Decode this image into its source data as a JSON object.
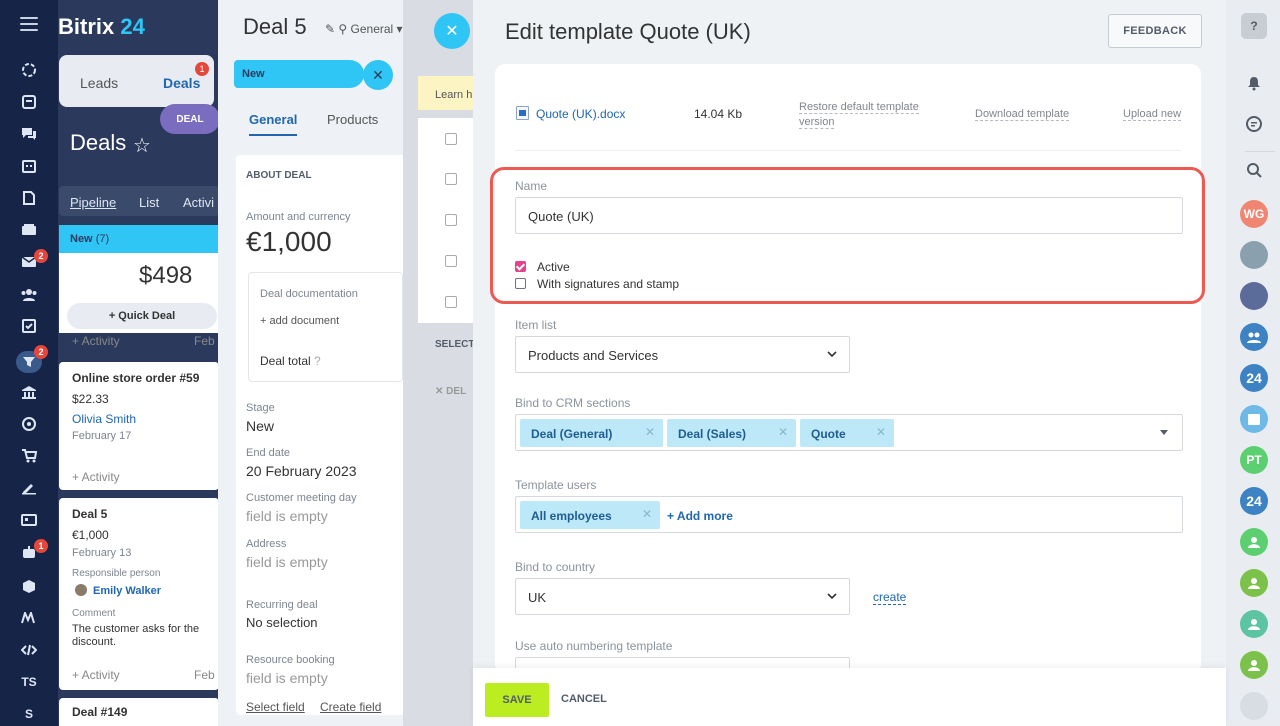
{
  "left_sidebar": {
    "badges": [
      "2",
      "2",
      "1"
    ],
    "bottom_label": "TS",
    "bottom_label_2": "S"
  },
  "crm": {
    "brand_name": "Bitrix",
    "brand_num": "24",
    "tab_leads": "Leads",
    "tab_deals": "Deals",
    "deals_badge": "1",
    "deal_pill": "DEAL",
    "page_title": "Deals",
    "view_tabs": [
      "Pipeline",
      "List",
      "Activi"
    ],
    "column_title": "New",
    "column_count": "(7)",
    "column_sum": "$498",
    "quick_deal": "+ Quick Deal",
    "activity": "+ Activity",
    "feb_short": "Feb",
    "cards": [
      {
        "title": "Online store order #59",
        "amount": "$22.33",
        "person": "Olivia Smith",
        "date": "February 17"
      },
      {
        "title": "Deal 5",
        "amount": "€1,000",
        "date": "February 13",
        "resp_label": "Responsible person",
        "person": "Emily Walker",
        "comment_label": "Comment",
        "comment": "The customer asks for the",
        "comment_2": "discount."
      },
      {
        "title": "Deal #149"
      }
    ]
  },
  "deal_panel": {
    "title": "Deal 5",
    "general_label": "General",
    "stage_new": "New",
    "tab_general": "General",
    "tab_products": "Products",
    "about": "ABOUT DEAL",
    "amount_label": "Amount and currency",
    "amount": "€1,000",
    "doc_label": "Deal documentation",
    "add_document": "+ add document",
    "deal_total": "Deal total",
    "stage_label": "Stage",
    "stage": "New",
    "end_date_label": "End date",
    "end_date": "20 February 2023",
    "meeting_label": "Customer meeting day",
    "field_empty": "field is empty",
    "address_label": "Address",
    "recurring_label": "Recurring deal",
    "recurring": "No selection",
    "resource_label": "Resource booking",
    "select_field": "Select field",
    "create_field": "Create field"
  },
  "list_panel": {
    "learn": "Learn h",
    "select": "SELECT",
    "delete": "DEL"
  },
  "slider": {
    "title": "Edit template Quote (UK)",
    "feedback": "FEEDBACK",
    "file_name": "Quote (UK).docx",
    "file_size": "14.04 Kb",
    "restore": "Restore default template",
    "restore_2": "version",
    "download": "Download template",
    "upload": "Upload new",
    "name_label": "Name",
    "name_value": "Quote (UK)",
    "active_label": "Active",
    "active_checked": true,
    "sign_label": "With signatures and stamp",
    "sign_checked": false,
    "item_list_label": "Item list",
    "item_list_value": "Products and Services",
    "bind_crm_label": "Bind to CRM sections",
    "crm_tags": [
      "Deal (General)",
      "Deal (Sales)",
      "Quote"
    ],
    "template_users_label": "Template users",
    "user_tags": [
      "All employees"
    ],
    "add_more": "+ Add more",
    "country_label": "Bind to country",
    "country_value": "UK",
    "create": "create",
    "auto_num_label": "Use auto numbering template",
    "save": "SAVE",
    "cancel": "CANCEL"
  },
  "right_rail": {
    "avatars": [
      "WG",
      "PT"
    ],
    "num_24": "24"
  },
  "colors": {
    "accent_blue": "#2fc6f6",
    "link": "#2067b0",
    "save_green": "#bbed21",
    "highlight_red": "#ec5a52",
    "checkbox_pink": "#e3428d"
  }
}
